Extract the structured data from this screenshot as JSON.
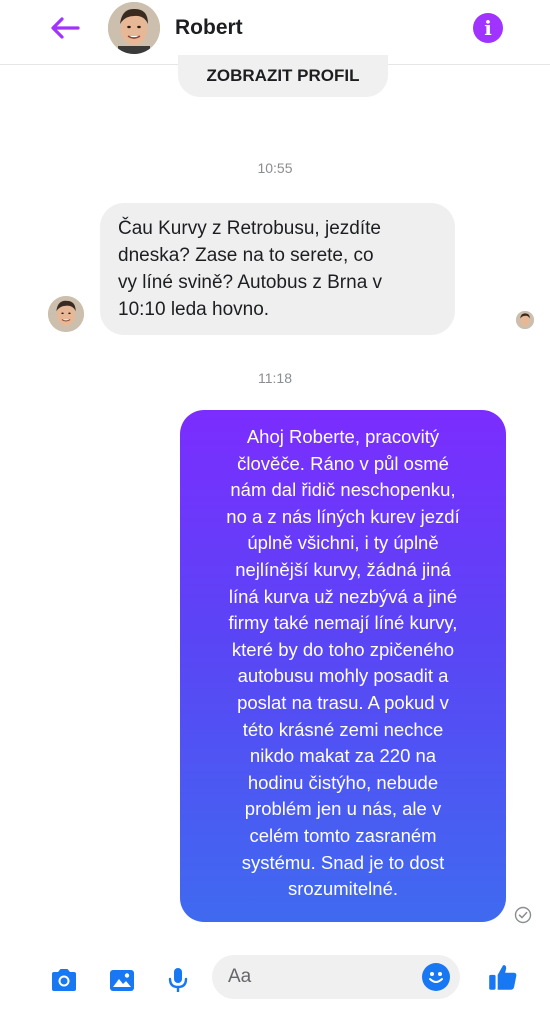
{
  "header": {
    "contact_name": "Robert",
    "back_icon": "arrow-left-icon",
    "info_icon": "info-icon",
    "accent_color": "#a033ff"
  },
  "profile_button": {
    "label": "ZOBRAZIT PROFIL"
  },
  "conversation": {
    "timestamp_1": "10:55",
    "incoming_message": {
      "lines": [
        "Čau Kurvy z Retrobusu, jezdíte",
        "dneska? Zase na to serete, co",
        "vy líné svině? Autobus z Brna v",
        "10:10 leda hovno."
      ]
    },
    "timestamp_2": "11:18",
    "outgoing_message": {
      "lines": [
        "Ahoj Roberte, pracovitý",
        "člověče. Ráno v půl osmé",
        "nám dal řidič neschopenku,",
        "no a z nás líných kurev jezdí",
        "úplně všichni, i ty úplně",
        "nejlínější kurvy, žádná jiná",
        "líná kurva už nezbývá a jiné",
        "firmy také nemají líné kurvy,",
        "které by do toho zpičeného",
        "autobusu mohly posadit a",
        "poslat na trasu. A pokud v",
        "této krásné zemi nechce",
        "nikdo makat za 220 na",
        "hodinu čistýho, nebude",
        "problém jen u nás, ale v",
        "celém tomto zasraném",
        "systému. Snad je to dost",
        "srozumitelné."
      ],
      "gradient_top": "#7b2dff",
      "gradient_bottom": "#3f6af0"
    }
  },
  "composer": {
    "placeholder": "Aa",
    "icons": [
      "camera-icon",
      "image-icon",
      "microphone-icon",
      "emoji-icon",
      "thumbs-up-icon"
    ],
    "icon_color": "#1877f2"
  }
}
